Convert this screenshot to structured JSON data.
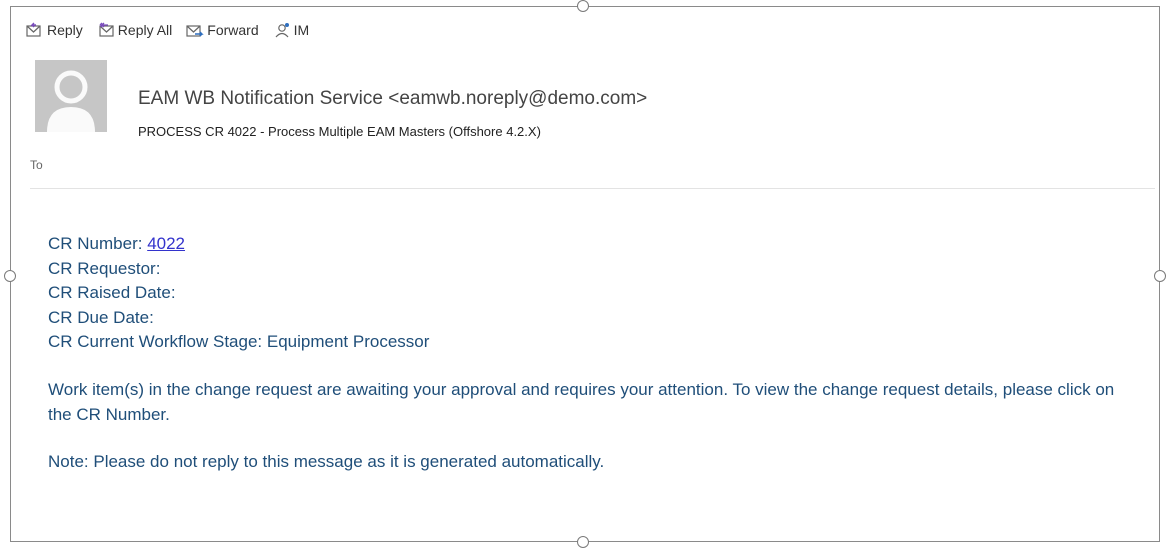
{
  "toolbar": {
    "reply": "Reply",
    "reply_all": "Reply All",
    "forward": "Forward",
    "im": "IM"
  },
  "message": {
    "sender": "EAM WB Notification Service <eamwb.noreply@demo.com>",
    "subject": "PROCESS CR 4022 - Process Multiple EAM Masters (Offshore 4.2.X)",
    "to_label": "To"
  },
  "body": {
    "cr_number_label": "CR Number: ",
    "cr_number_link": "4022",
    "cr_requestor": "CR Requestor:",
    "cr_raised_date": "CR Raised Date:",
    "cr_due_date": "CR Due Date:",
    "cr_stage": "CR Current Workflow Stage: Equipment Processor",
    "paragraph": "Work item(s) in the change request are awaiting your approval and requires your attention. To view the change request details, please click on the CR Number.",
    "note": "Note: Please do not reply to this message as it is generated automatically."
  },
  "colors": {
    "body_text": "#1f4e79",
    "link": "#3333cc"
  }
}
